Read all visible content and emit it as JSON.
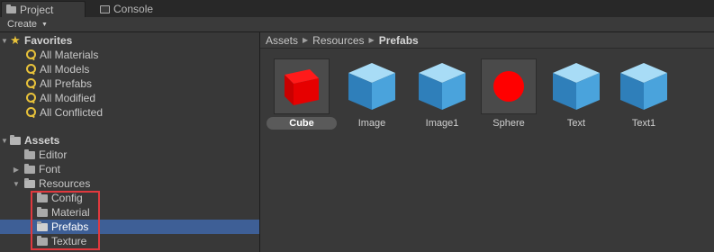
{
  "tabs": [
    {
      "label": "Project",
      "icon": "folder-icon",
      "active": true
    },
    {
      "label": "Console",
      "icon": "console-icon",
      "active": false
    }
  ],
  "toolbar": {
    "create_label": "Create"
  },
  "favorites": {
    "label": "Favorites",
    "items": [
      "All Materials",
      "All Models",
      "All Prefabs",
      "All Modified",
      "All Conflicted"
    ]
  },
  "assets": {
    "label": "Assets",
    "children": [
      {
        "label": "Editor"
      },
      {
        "label": "Font"
      },
      {
        "label": "Resources",
        "children": [
          "Config",
          "Material",
          "Prefabs",
          "Texture"
        ]
      }
    ],
    "selected": "Prefabs"
  },
  "breadcrumb": [
    "Assets",
    "Resources",
    "Prefabs"
  ],
  "grid_items": [
    {
      "label": "Cube",
      "thumbnail": "red-cube",
      "selected": true
    },
    {
      "label": "Image",
      "thumbnail": "blue-cube",
      "selected": false
    },
    {
      "label": "Image1",
      "thumbnail": "blue-cube",
      "selected": false
    },
    {
      "label": "Sphere",
      "thumbnail": "red-sphere",
      "selected": false
    },
    {
      "label": "Text",
      "thumbnail": "blue-cube",
      "selected": false
    },
    {
      "label": "Text1",
      "thumbnail": "blue-cube",
      "selected": false
    }
  ],
  "colors": {
    "selection": "#3e5f96",
    "highlight": "#e0393e",
    "favorite": "#e8c23a",
    "prefab_red": "#e00000",
    "prefab_blue": "#4aa3dc"
  }
}
